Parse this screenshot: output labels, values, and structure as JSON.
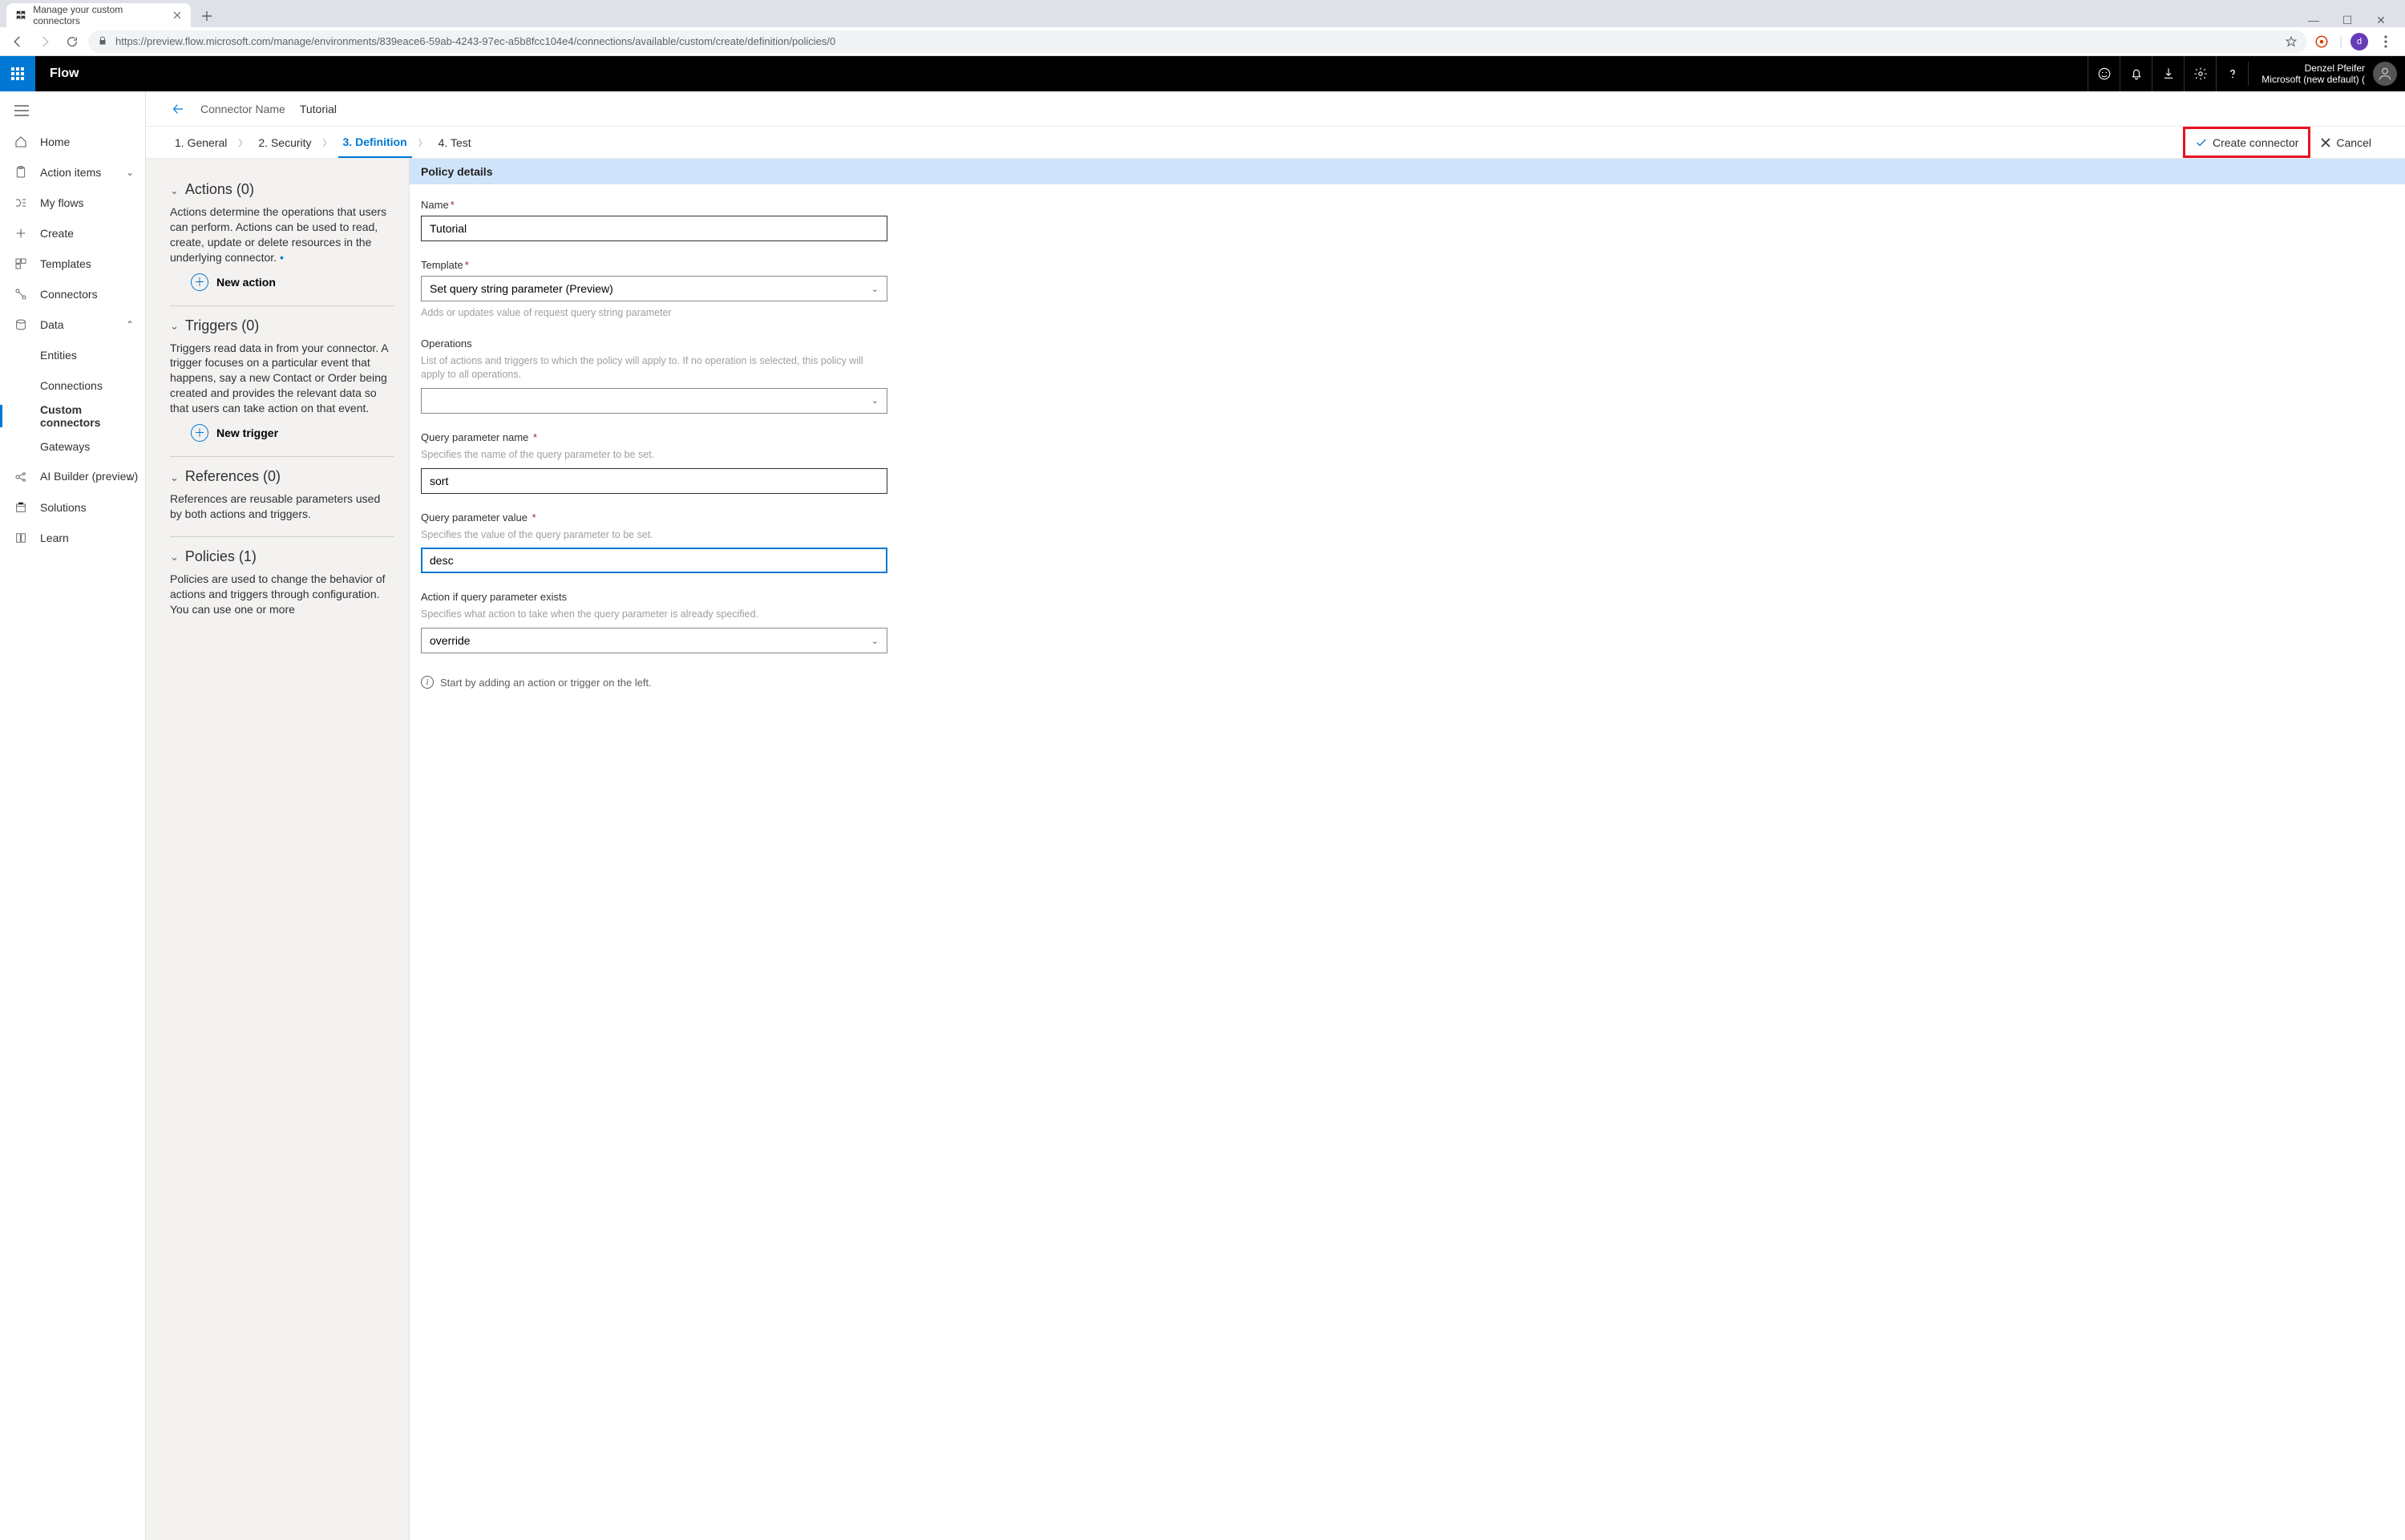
{
  "browser": {
    "tab_title": "Manage your custom connectors",
    "url": "https://preview.flow.microsoft.com/manage/environments/839eace6-59ab-4243-97ec-a5b8fcc104e4/connections/available/custom/create/definition/policies/0",
    "avatar_letter": "d"
  },
  "appheader": {
    "app_name": "Flow",
    "user_name": "Denzel Pfeifer",
    "tenant": "Microsoft (new default) ("
  },
  "sidebar": {
    "items": [
      {
        "label": "Home"
      },
      {
        "label": "Action items"
      },
      {
        "label": "My flows"
      },
      {
        "label": "Create"
      },
      {
        "label": "Templates"
      },
      {
        "label": "Connectors"
      },
      {
        "label": "Data"
      }
    ],
    "data_children": [
      {
        "label": "Entities"
      },
      {
        "label": "Connections"
      },
      {
        "label": "Custom connectors"
      },
      {
        "label": "Gateways"
      }
    ],
    "tail": [
      {
        "label": "AI Builder (preview)"
      },
      {
        "label": "Solutions"
      },
      {
        "label": "Learn"
      }
    ]
  },
  "connectorbar": {
    "label": "Connector Name",
    "value": "Tutorial"
  },
  "steps": {
    "s1": "1. General",
    "s2": "2. Security",
    "s3": "3. Definition",
    "s4": "4. Test",
    "create": "Create connector",
    "cancel": "Cancel"
  },
  "defpanel": {
    "actions": {
      "title": "Actions (0)",
      "desc": "Actions determine the operations that users can perform. Actions can be used to read, create, update or delete resources in the underlying connector.",
      "add": "New action"
    },
    "triggers": {
      "title": "Triggers (0)",
      "desc": "Triggers read data in from your connector. A trigger focuses on a particular event that happens, say a new Contact or Order being created and provides the relevant data so that users can take action on that event.",
      "add": "New trigger"
    },
    "references": {
      "title": "References (0)",
      "desc": "References are reusable parameters used by both actions and triggers."
    },
    "policies": {
      "title": "Policies (1)",
      "desc": "Policies are used to change the behavior of actions and triggers through configuration. You can use one or more"
    }
  },
  "form": {
    "panel_title": "Policy details",
    "name_label": "Name",
    "name_value": "Tutorial",
    "template_label": "Template",
    "template_value": "Set query string parameter (Preview)",
    "template_hint": "Adds or updates value of request query string parameter",
    "operations_label": "Operations",
    "operations_hint": "List of actions and triggers to which the policy will apply to. If no operation is selected, this policy will apply to all operations.",
    "operations_value": "",
    "qpname_label": "Query parameter name",
    "qpname_hint": "Specifies the name of the query parameter to be set.",
    "qpname_value": "sort",
    "qpvalue_label": "Query parameter value",
    "qpvalue_hint": "Specifies the value of the query parameter to be set.",
    "qpvalue_value": "desc",
    "action_label": "Action if query parameter exists",
    "action_hint": "Specifies what action to take when the query parameter is already specified.",
    "action_value": "override",
    "footnote": "Start by adding an action or trigger on the left."
  }
}
